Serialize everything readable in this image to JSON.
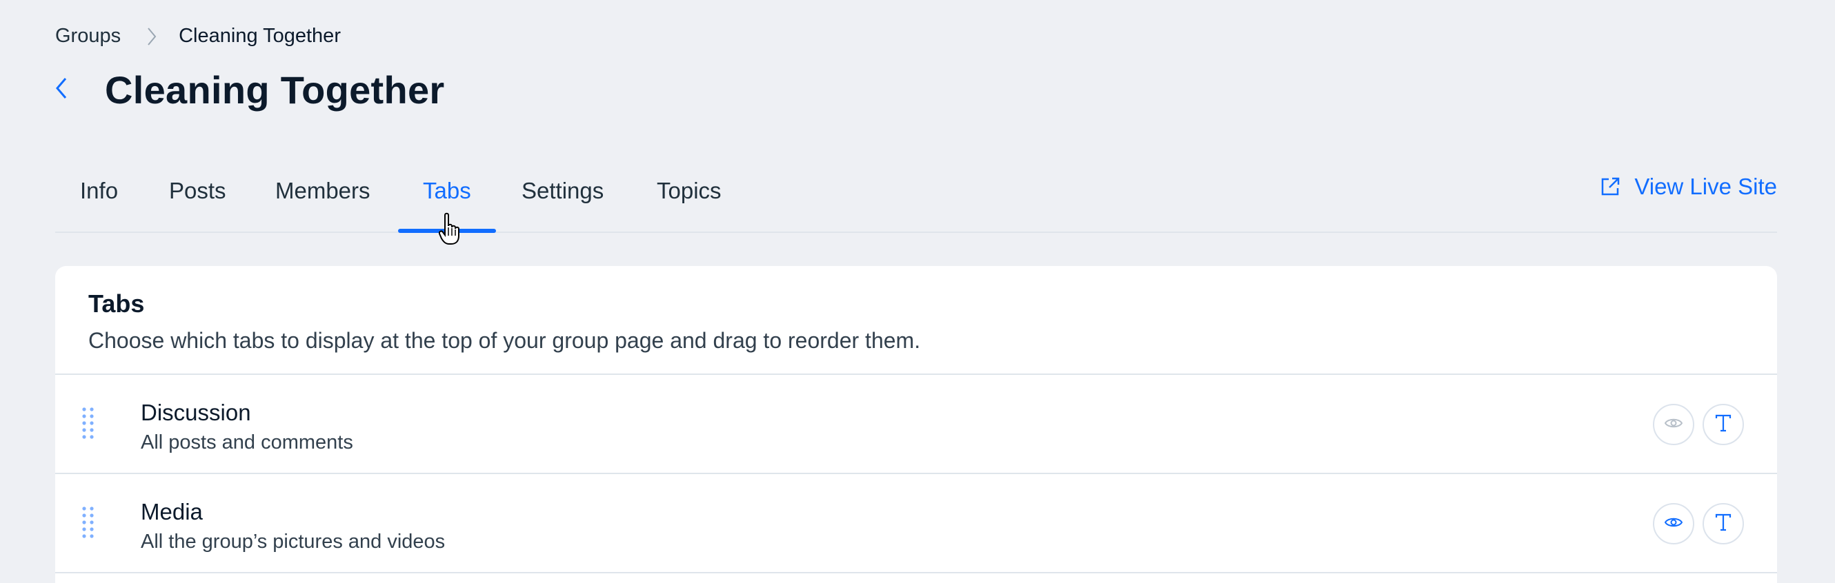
{
  "breadcrumb": {
    "root": "Groups",
    "current": "Cleaning Together"
  },
  "page": {
    "title": "Cleaning Together"
  },
  "tabs": [
    {
      "label": "Info"
    },
    {
      "label": "Posts"
    },
    {
      "label": "Members"
    },
    {
      "label": "Tabs",
      "active": true
    },
    {
      "label": "Settings"
    },
    {
      "label": "Topics"
    }
  ],
  "view_live": {
    "label": "View Live Site"
  },
  "card": {
    "title": "Tabs",
    "subtitle": "Choose which tabs to display at the top of your group page and drag to reorder them.",
    "items": [
      {
        "title": "Discussion",
        "description": "All posts and comments",
        "visibility": "disabled"
      },
      {
        "title": "Media",
        "description": "All the group’s pictures and videos",
        "visibility": "enabled"
      }
    ]
  },
  "icons": {
    "accent": "#116dff",
    "back": "chevron-left-icon",
    "external": "external-link-icon",
    "drag": "drag-handle-icon",
    "eye": "eye-icon",
    "text": "text-icon"
  }
}
